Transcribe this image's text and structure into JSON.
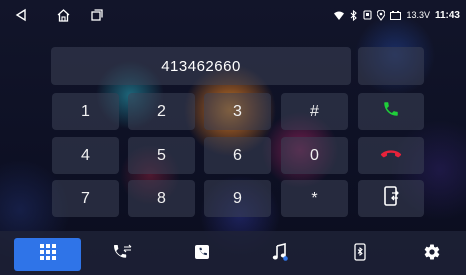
{
  "status": {
    "battery_voltage": "13.3V",
    "time": "11:43"
  },
  "dialer": {
    "number": "413462660"
  },
  "keypad": [
    {
      "label": "1"
    },
    {
      "label": "2"
    },
    {
      "label": "3"
    },
    {
      "label": "#"
    },
    {
      "label": "4"
    },
    {
      "label": "5"
    },
    {
      "label": "6"
    },
    {
      "label": "0"
    },
    {
      "label": "7"
    },
    {
      "label": "8"
    },
    {
      "label": "9"
    },
    {
      "label": "*"
    }
  ],
  "colors": {
    "call": "#1fcf3a",
    "hangup": "#e8223a",
    "active_tab": "#2f74e8"
  },
  "bottom_nav": [
    {
      "icon": "keypad-grid-icon",
      "active": true
    },
    {
      "icon": "call-log-icon",
      "active": false
    },
    {
      "icon": "contacts-icon",
      "active": false
    },
    {
      "icon": "music-icon",
      "active": false
    },
    {
      "icon": "bluetooth-phone-icon",
      "active": false
    },
    {
      "icon": "settings-gear-icon",
      "active": false
    }
  ]
}
